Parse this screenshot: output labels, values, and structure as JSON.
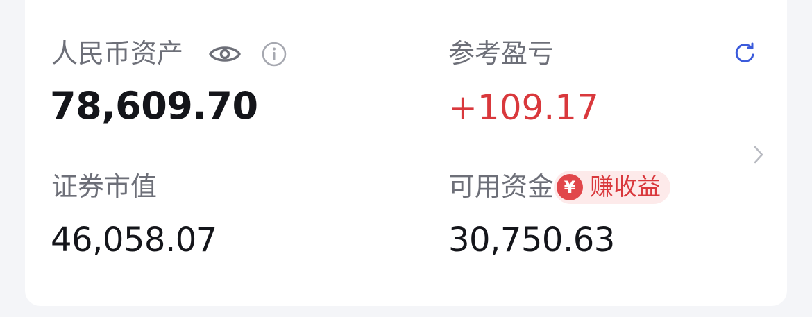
{
  "assets": {
    "rmb_assets_label": "人民币资产",
    "rmb_assets_value": "78,609.70",
    "reference_pl_label": "参考盈亏",
    "reference_pl_value": "+109.17",
    "securities_value_label": "证券市值",
    "securities_value_value": "46,058.07",
    "available_funds_label": "可用资金",
    "available_funds_value": "30,750.63"
  },
  "badge": {
    "coin_symbol": "¥",
    "label": "赚收益"
  },
  "icons": {
    "eye": "eye-icon",
    "info": "info-icon",
    "refresh": "refresh-icon",
    "chevron": "chevron-right-icon"
  },
  "colors": {
    "profit": "#d9383c",
    "refresh": "#3b5bdb",
    "label": "#6d6f78",
    "value": "#14151a"
  }
}
